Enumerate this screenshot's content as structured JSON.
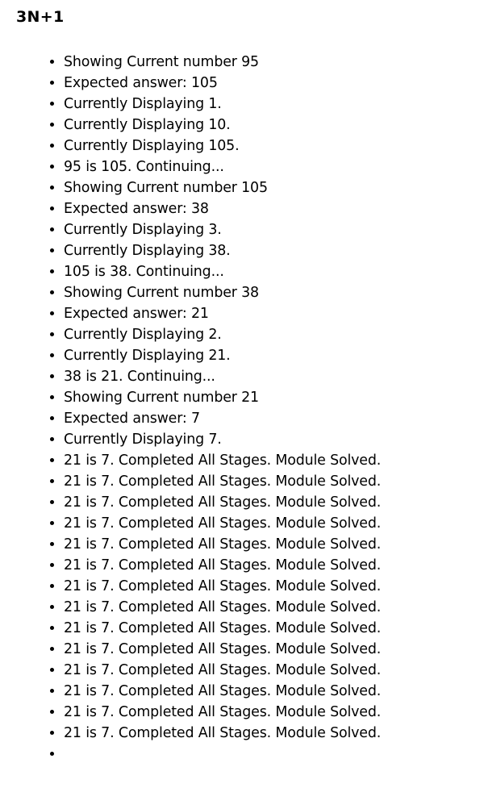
{
  "page": {
    "title": "3N+1"
  },
  "log": [
    "Showing Current number 95",
    "Expected answer: 105",
    "Currently Displaying 1.",
    "Currently Displaying 10.",
    "Currently Displaying 105.",
    "95 is 105. Continuing...",
    "Showing Current number 105",
    "Expected answer: 38",
    "Currently Displaying 3.",
    "Currently Displaying 38.",
    "105 is 38. Continuing...",
    "Showing Current number 38",
    "Expected answer: 21",
    "Currently Displaying 2.",
    "Currently Displaying 21.",
    "38 is 21. Continuing...",
    "Showing Current number 21",
    "Expected answer: 7",
    "Currently Displaying 7.",
    "21 is 7. Completed All Stages. Module Solved.",
    "21 is 7. Completed All Stages. Module Solved.",
    "21 is 7. Completed All Stages. Module Solved.",
    "21 is 7. Completed All Stages. Module Solved.",
    "21 is 7. Completed All Stages. Module Solved.",
    "21 is 7. Completed All Stages. Module Solved.",
    "21 is 7. Completed All Stages. Module Solved.",
    "21 is 7. Completed All Stages. Module Solved.",
    "21 is 7. Completed All Stages. Module Solved.",
    "21 is 7. Completed All Stages. Module Solved.",
    "21 is 7. Completed All Stages. Module Solved.",
    "21 is 7. Completed All Stages. Module Solved.",
    "21 is 7. Completed All Stages. Module Solved.",
    "21 is 7. Completed All Stages. Module Solved."
  ]
}
